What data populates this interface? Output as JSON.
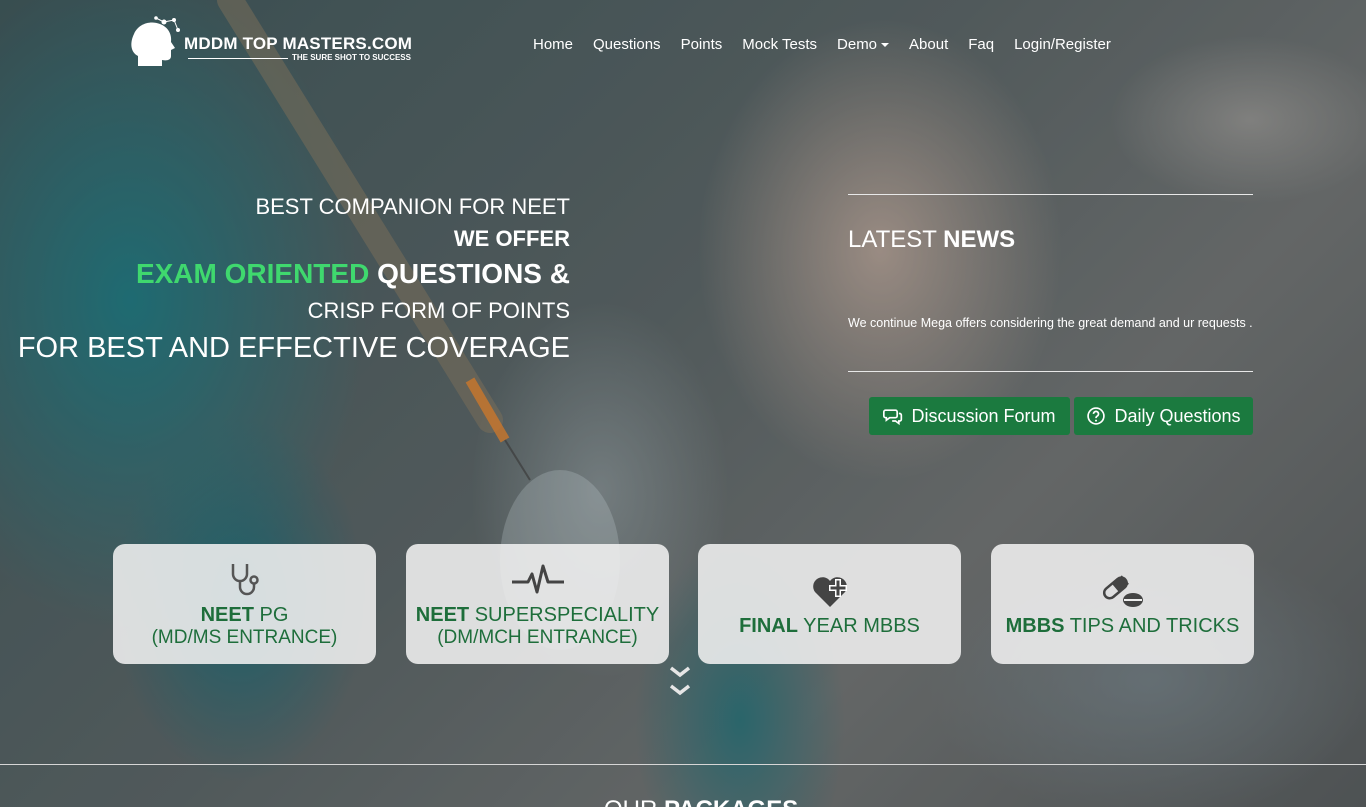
{
  "brand": {
    "name": "MDDM TOP MASTERS.COM",
    "tagline": "THE SURE SHOT TO SUCCESS"
  },
  "nav": {
    "items": [
      {
        "label": "Home"
      },
      {
        "label": "Questions"
      },
      {
        "label": "Points"
      },
      {
        "label": "Mock Tests"
      },
      {
        "label": "Demo"
      },
      {
        "label": "About"
      },
      {
        "label": "Faq"
      },
      {
        "label": "Login/Register"
      }
    ]
  },
  "hero": {
    "line1": "BEST COMPANION FOR NEET",
    "line2": "WE OFFER",
    "line3_highlight": "EXAM ORIENTED",
    "line3_rest": " QUESTIONS &",
    "line4": "CRISP FORM OF POINTS",
    "line5": "FOR BEST AND EFFECTIVE COVERAGE"
  },
  "news": {
    "title_light": "LATEST ",
    "title_bold": "NEWS",
    "text": "We continue Mega offers considering the great demand and ur requests ..",
    "forum_button": "Discussion Forum",
    "daily_button": "Daily Questions"
  },
  "cards": [
    {
      "bold": "NEET",
      "rest": " PG",
      "line2": "(MD/MS ENTRANCE)",
      "icon": "stethoscope-icon"
    },
    {
      "bold": "NEET",
      "rest": " SUPERSPECIALITY",
      "line2": "(DM/MCH ENTRANCE)",
      "icon": "heartbeat-icon"
    },
    {
      "bold": "FINAL",
      "rest": " YEAR MBBS",
      "line2": "",
      "icon": "heart-plus-icon"
    },
    {
      "bold": "MBBS",
      "rest": " TIPS AND TRICKS",
      "line2": "",
      "icon": "pills-icon"
    }
  ],
  "packages": {
    "title_light": "OUR ",
    "title_bold": "PACKAGES"
  },
  "colors": {
    "accent_green": "#1b7a3f",
    "highlight_green": "#3fd86e",
    "card_text": "#1e6e3b"
  }
}
